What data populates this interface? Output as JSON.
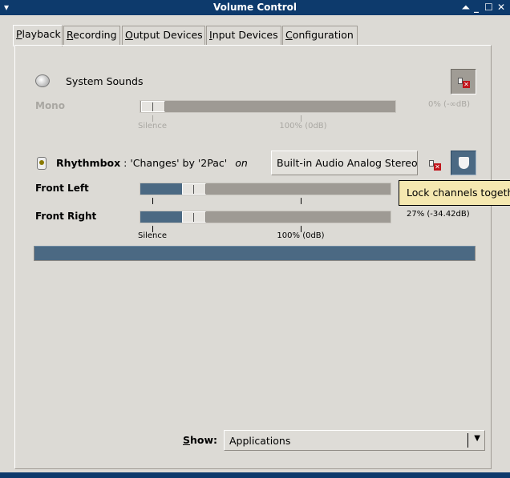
{
  "window": {
    "title": "Volume Control",
    "menu_icon": "window-menu-icon",
    "controls": [
      "shade-icon",
      "minimize-icon",
      "maximize-icon",
      "close-icon"
    ]
  },
  "tabs": [
    {
      "key": "P",
      "rest": "layback",
      "active": true
    },
    {
      "key": "R",
      "rest": "ecording"
    },
    {
      "key": "O",
      "rest": "utput Devices"
    },
    {
      "key": "I",
      "rest": "nput Devices"
    },
    {
      "key": "C",
      "rest": "onfiguration"
    }
  ],
  "system_sounds": {
    "name": "System Sounds",
    "channel": "Mono",
    "volume_percent": 0,
    "volume_text": "0% (-∞dB)",
    "muted": true,
    "tick_labels": [
      "Silence",
      "100% (0dB)"
    ]
  },
  "stream": {
    "app": "Rhythmbox",
    "description": ": 'Changes' by '2Pac'",
    "on_label": "on",
    "device_button": "Built-in Audio Analog Stereo",
    "lock_channels": true,
    "channels": [
      {
        "name": "Front Left",
        "volume_percent": 27
      },
      {
        "name": "Front Right",
        "volume_percent": 27
      }
    ],
    "volume_text": "27% (-34.42dB)",
    "tick_labels": [
      "Silence",
      "100% (0dB)"
    ],
    "level_percent": 100
  },
  "tooltip": "Lock channels together",
  "show": {
    "key": "S",
    "rest": "how:",
    "value": "Applications"
  },
  "colors": {
    "titlebar": "#0d3a6c",
    "accent": "#4b6983",
    "tooltip": "#f5e8b0"
  }
}
